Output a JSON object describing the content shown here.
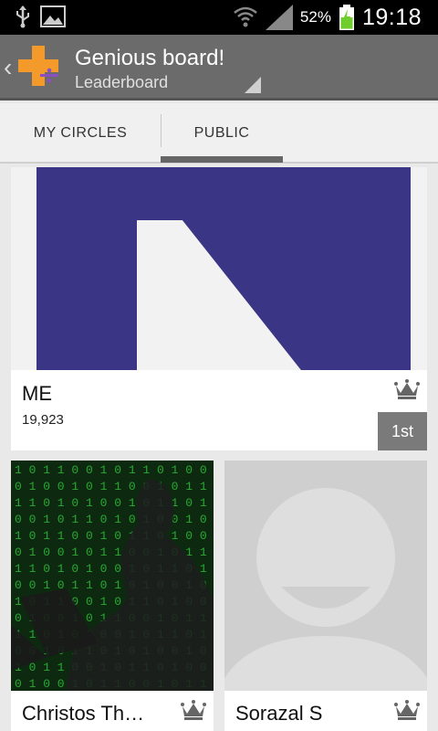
{
  "status_bar": {
    "battery_percent": "52%",
    "time": "19:18",
    "icons": [
      "usb-icon",
      "image-icon",
      "wifi-icon",
      "signal-icon",
      "battery-charging-icon"
    ]
  },
  "action_bar": {
    "title": "Genious board!",
    "subtitle": "Leaderboard",
    "icons": [
      "back-chevron-icon",
      "app-logo-icon",
      "spinner-indicator-icon"
    ]
  },
  "tabs": [
    {
      "label": "MY CIRCLES",
      "selected": false
    },
    {
      "label": "PUBLIC",
      "selected": true
    }
  ],
  "leaderboard": {
    "me": {
      "name": "ME",
      "score": "19,923",
      "rank": "1st"
    },
    "players": [
      {
        "name": "Christos Th…"
      },
      {
        "name": "Sorazal S"
      }
    ]
  },
  "colors": {
    "action_bar": "#6b6b6b",
    "tab_indicator": "#666666",
    "brand_orange": "#f39a2a",
    "brand_purple": "#8a4fc2",
    "avatar_blue": "#3a3585",
    "matrix_green": "#2fbf3a"
  }
}
